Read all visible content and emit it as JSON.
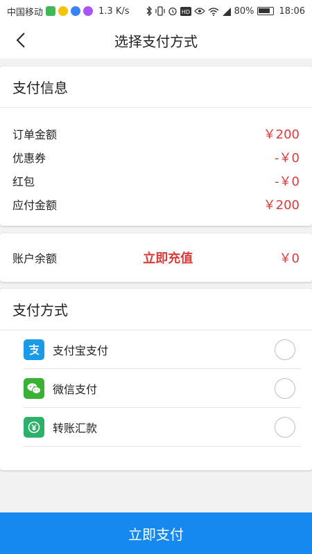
{
  "status_bar": {
    "carrier": "中国移动",
    "speed": "1.3 K/s",
    "battery": "80%",
    "time": "18:06",
    "left_icons": [
      "wechat-icon",
      "yy-icon",
      "music-icon",
      "app-icon"
    ],
    "right_icons": [
      "bluetooth-icon",
      "vibrate-icon",
      "alarm-icon",
      "hd-icon",
      "eye-icon",
      "wifi-icon",
      "signal-icon",
      "battery-icon"
    ]
  },
  "nav": {
    "title": "选择支付方式",
    "back_icon": "chevron-left-icon"
  },
  "payment_info": {
    "title": "支付信息",
    "rows": [
      {
        "label": "订单金额",
        "value": "￥200"
      },
      {
        "label": "优惠券",
        "value": "-￥0"
      },
      {
        "label": "红包",
        "value": "-￥0"
      },
      {
        "label": "应付金额",
        "value": "￥200"
      }
    ]
  },
  "balance": {
    "label": "账户余额",
    "recharge": "立即充值",
    "value": "￥0"
  },
  "methods": {
    "title": "支付方式",
    "items": [
      {
        "label": "支付宝支付",
        "icon": "alipay-icon",
        "color": "#1a9be8"
      },
      {
        "label": "微信支付",
        "icon": "wechat-pay-icon",
        "color": "#3cb034"
      },
      {
        "label": "转账汇款",
        "icon": "transfer-icon",
        "color": "#2fb06a"
      }
    ]
  },
  "pay_button": {
    "label": "立即支付",
    "color": "#1589f0"
  },
  "colors": {
    "accent_red": "#d93a3a",
    "primary_blue": "#1589f0"
  }
}
